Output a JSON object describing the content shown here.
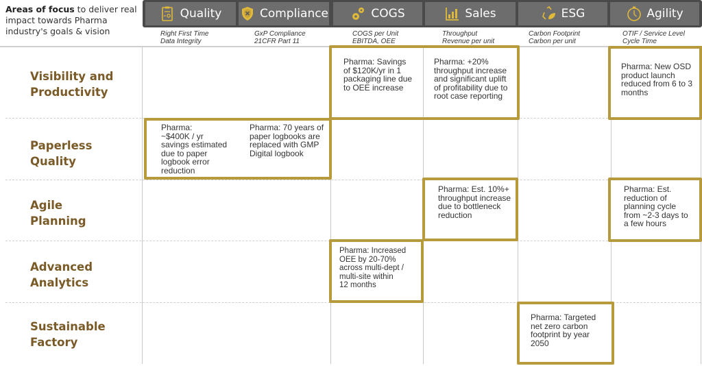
{
  "intro": {
    "bold": "Areas of focus",
    "rest": " to deliver real impact towards Pharma industry's goals & vision"
  },
  "colors": {
    "gold": "#b89a3e",
    "header_bg": "#6d6d6d",
    "header_band": "#4a4a4a",
    "row_label": "#7a5a26"
  },
  "columns": [
    {
      "label": "Quality",
      "icon": "clipboard-certificate-icon",
      "kpis": [
        "Right First Time",
        "Data Integrity"
      ]
    },
    {
      "label": "Compliance",
      "icon": "shield-x-icon",
      "kpis": [
        "GxP Compliance",
        "21CFR Part 11"
      ]
    },
    {
      "label": "COGS",
      "icon": "gears-icon",
      "kpis": [
        "COGS per Unit",
        "EBITDA, OEE"
      ]
    },
    {
      "label": "Sales",
      "icon": "bar-chart-icon",
      "kpis": [
        "Throughput",
        "Revenue per unit"
      ]
    },
    {
      "label": "ESG",
      "icon": "recycle-leaf-icon",
      "kpis": [
        "Carbon Footprint",
        "Carbon per unit"
      ]
    },
    {
      "label": "Agility",
      "icon": "stopwatch-icon",
      "kpis": [
        "OTIF / Service Level",
        "Cycle Time"
      ]
    }
  ],
  "rows": [
    {
      "label": [
        "Visibility and",
        "Productivity"
      ]
    },
    {
      "label": [
        "Paperless",
        "Quality"
      ]
    },
    {
      "label": [
        "Agile",
        "Planning"
      ]
    },
    {
      "label": [
        "Advanced",
        "Analytics"
      ]
    },
    {
      "label": [
        "Sustainable",
        "Factory"
      ]
    }
  ],
  "notes": {
    "vp_cogs": [
      "Pharma: Savings",
      "of $120K/yr in 1",
      "packaging line due",
      "to OEE increase"
    ],
    "vp_sales": [
      "Pharma: +20%",
      "throughput increase",
      "and significant uplift",
      "of profitability due to",
      "root case reporting"
    ],
    "vp_agility": [
      "Pharma: New OSD",
      "product launch",
      "reduced from 6 to 3",
      "months"
    ],
    "pq_quality": [
      "Pharma:",
      "~$400K / yr",
      "savings estimated",
      "due to paper",
      "logbook error",
      "reduction"
    ],
    "pq_compliance": [
      "Pharma: 70 years of",
      "paper logbooks are",
      "replaced with GMP",
      "Digital logbook"
    ],
    "ap_sales": [
      "Pharma: Est. 10%+",
      "throughput increase",
      "due to bottleneck",
      "reduction"
    ],
    "ap_agility": [
      "Pharma: Est.",
      "reduction of",
      "planning cycle",
      "from ~2-3 days to",
      "a few hours"
    ],
    "aa_cogs": [
      "Pharma: Increased",
      "OEE by 20-70%",
      "across multi-dept /",
      "multi-site within",
      "12 months"
    ],
    "sf_esg": [
      "Pharma: Targeted",
      "net zero carbon",
      "footprint by year",
      "2050"
    ]
  }
}
